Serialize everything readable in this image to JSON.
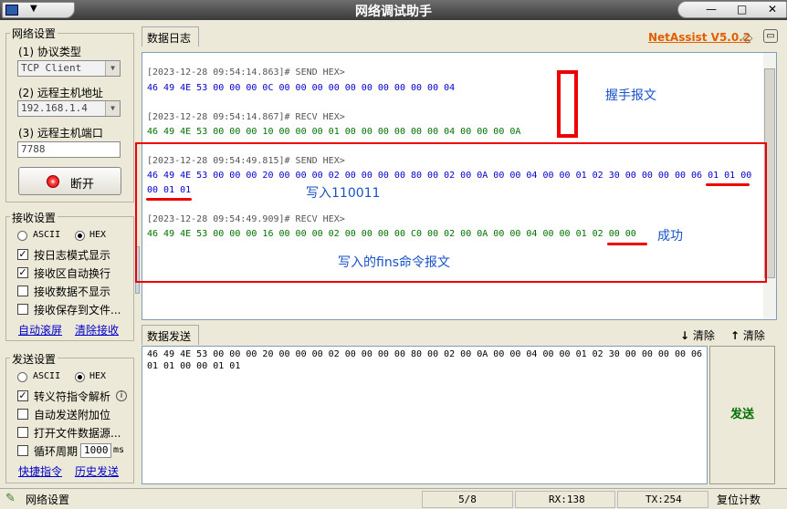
{
  "window": {
    "title": "网络调试助手",
    "min_icon": "minimize-icon",
    "max_icon": "maximize-icon",
    "close_icon": "close-icon"
  },
  "brand": {
    "name": "NetAssist V5.0.2"
  },
  "network": {
    "group_label": "网络设置",
    "protocol_label": "(1) 协议类型",
    "protocol_value": "TCP Client",
    "host_label": "(2) 远程主机地址",
    "host_value": "192.168.1.4",
    "port_label": "(3) 远程主机端口",
    "port_value": "7788",
    "disconnect_label": "断开"
  },
  "receive": {
    "group_label": "接收设置",
    "ascii": "ASCII",
    "hex": "HEX",
    "log_mode": "按日志模式显示",
    "auto_wrap": "接收区自动换行",
    "hide_data": "接收数据不显示",
    "save_file": "接收保存到文件...",
    "auto_scroll": "自动滚屏",
    "clear_recv": "清除接收"
  },
  "send": {
    "group_label": "发送设置",
    "ascii": "ASCII",
    "hex": "HEX",
    "escape": "转义符指令解析",
    "auto_append": "自动发送附加位",
    "open_file": "打开文件数据源...",
    "loop": "循环周期",
    "loop_value": "1000",
    "loop_unit": "ms",
    "shortcut": "快捷指令",
    "history": "历史发送"
  },
  "log": {
    "tab": "数据日志",
    "entries": [
      {
        "header": "[2023-12-28 09:54:14.863]# SEND HEX>",
        "line1": "46 49 4E 53 00 00 00 0C 00 00 00 00 00 00 00 00 00 00 04",
        "line2": ""
      },
      {
        "header": "[2023-12-28 09:54:14.867]# RECV HEX>",
        "line1": "46 49 4E 53 00 00 00 10 00 00 00 01 00 00 00 00 00 00 04 00 00 00 0A",
        "line2": ""
      },
      {
        "header": "[2023-12-28 09:54:49.815]# SEND HEX>",
        "line1": "46 49 4E 53 00 00 00 20 00 00 00 02 00 00 00 00 80 00 02 00 0A 00 00 04 00 00 01 02 30 00 00 00 00 06 01 01 00",
        "line2": "00 01 01"
      },
      {
        "header": "[2023-12-28 09:54:49.909]# RECV HEX>",
        "line1": "46 49 4E 53 00 00 00 16 00 00 00 02 00 00 00 00 C0 00 02 00 0A 00 00 04 00 00 01 02 00 00",
        "line2": ""
      }
    ]
  },
  "annotations": {
    "handshake": "握手报文",
    "write_value": "写入110011",
    "success": "成功",
    "fins_cmd": "写入的fins命令报文"
  },
  "send_panel": {
    "tab": "数据发送",
    "clear1": "清除",
    "clear2": "清除",
    "content_line1": "46 49 4E 53 00 00 00 20 00 00 00 02 00 00 00 00 80 00 02 00 0A 00 00 04 00 00 01 02 30 00 00 00 00 06",
    "content_line2": "01 01 00 00 01 01",
    "send_button": "发送"
  },
  "status": {
    "label": "网络设置",
    "page": "5/8",
    "rx": "RX:138",
    "tx": "TX:254",
    "reset": "复位计数"
  },
  "colors": {
    "send": "#0000cc",
    "recv": "#007000",
    "annotation": "#1a52c8",
    "highlight": "#e00000",
    "brand": "#e06000"
  }
}
